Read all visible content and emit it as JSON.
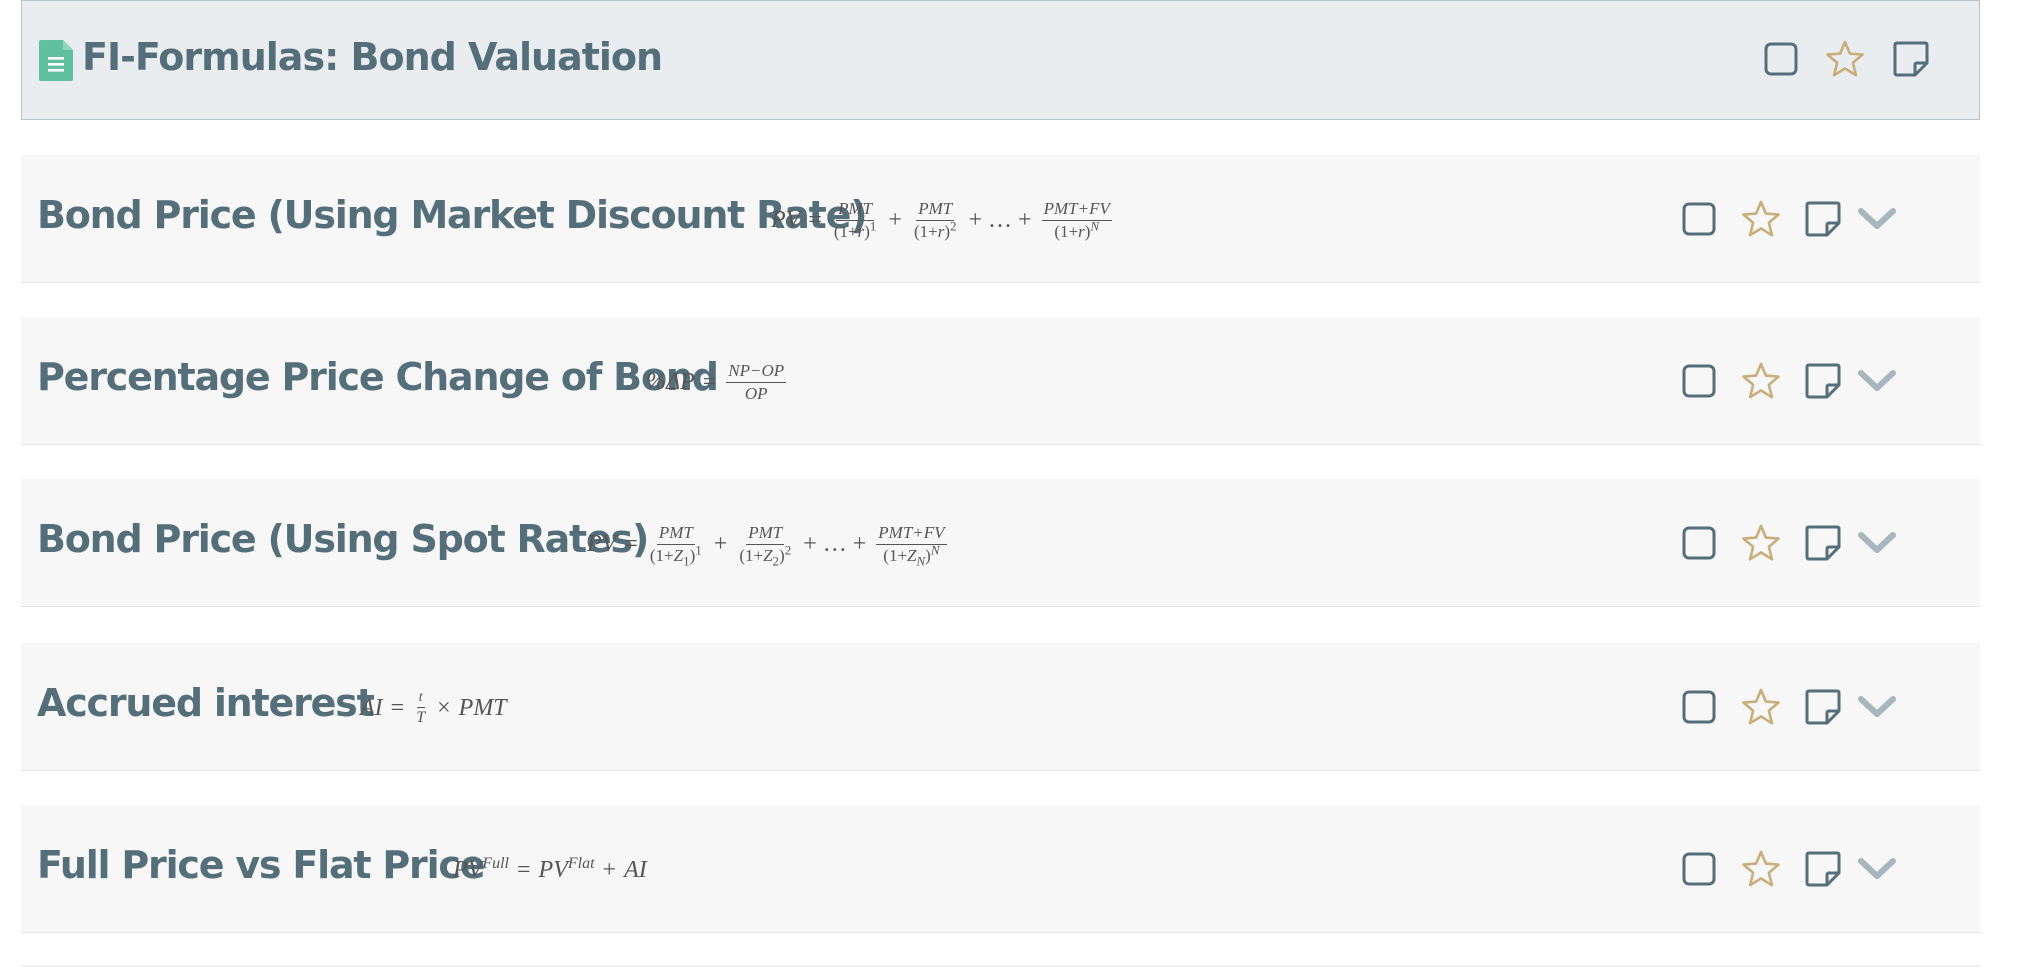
{
  "header": {
    "title": "FI-Formulas: Bond Valuation",
    "icons": [
      "document-icon",
      "checkbox-icon",
      "star-icon",
      "note-icon"
    ]
  },
  "cards": [
    {
      "title": "Bond Price (Using Market Discount Rate)",
      "formula": "PV = PMT/(1+r)^1 + PMT/(1+r)^2 + … + (PMT+FV)/(1+r)^N"
    },
    {
      "title": "Percentage Price Change of Bond",
      "formula": "%ΔP = (NP−OP)/OP"
    },
    {
      "title": "Bond Price (Using Spot Rates)",
      "formula": "PV = PMT/(1+Z1)^1 + PMT/(1+Z2)^2 + … + (PMT+FV)/(1+ZN)^N"
    },
    {
      "title": "Accrued interest",
      "formula": "AI = t/T × PMT"
    },
    {
      "title": "Full Price vs Flat Price",
      "formula": "PV^Full = PV^Flat + AI"
    }
  ],
  "colors": {
    "title": "#546e7a",
    "star": "#c8ae7a",
    "icon": "#546e7a",
    "chevron": "#a8b6bd",
    "doc_icon": "#5fbf9f",
    "header_bg": "#e9edef",
    "card_bg": "#f7f7f7"
  }
}
